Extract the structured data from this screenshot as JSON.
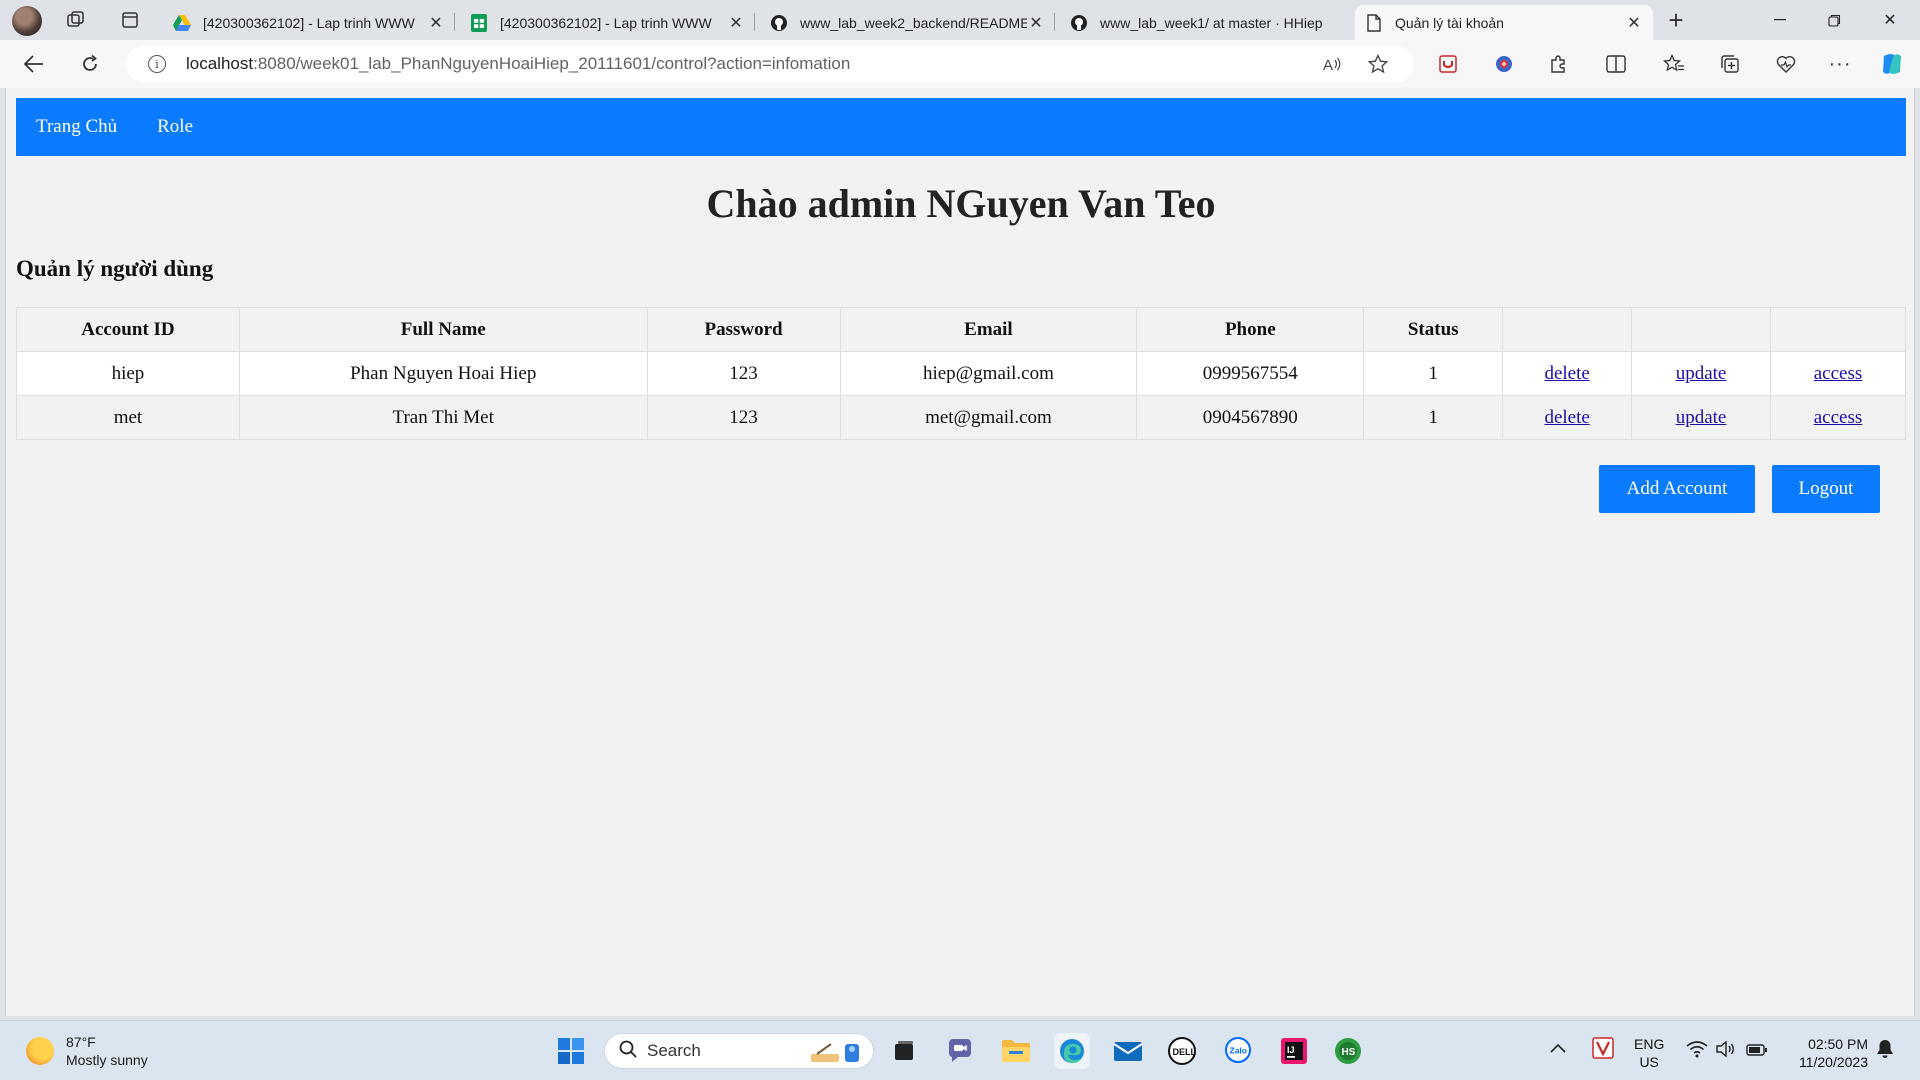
{
  "browser": {
    "tabs": [
      {
        "title": "[420300362102] - Lap trinh WWW",
        "icon": "google-drive-icon"
      },
      {
        "title": "[420300362102] - Lap trinh WWW",
        "icon": "google-sheets-icon"
      },
      {
        "title": "www_lab_week2_backend/README",
        "icon": "github-icon"
      },
      {
        "title": "www_lab_week1/ at master · HHiep",
        "icon": "github-icon"
      },
      {
        "title": "Quản lý tài khoản",
        "icon": "page-icon",
        "active": true
      }
    ],
    "url_host": "localhost",
    "url_path": ":8080/week01_lab_PhanNguyenHoaiHiep_20111601/control?action=infomation"
  },
  "page": {
    "nav": {
      "home": "Trang Chủ",
      "role": "Role"
    },
    "greeting": "Chào admin NGuyen Van Teo",
    "section_title": "Quản lý người dùng",
    "table": {
      "headers": [
        "Account ID",
        "Full Name",
        "Password",
        "Email",
        "Phone",
        "Status",
        "",
        "",
        ""
      ],
      "rows": [
        {
          "account_id": "hiep",
          "full_name": "Phan Nguyen Hoai Hiep",
          "password": "123",
          "email": "hiep@gmail.com",
          "phone": "0999567554",
          "status": "1",
          "delete": "delete",
          "update": "update",
          "access": "access"
        },
        {
          "account_id": "met",
          "full_name": "Tran Thi Met",
          "password": "123",
          "email": "met@gmail.com",
          "phone": "0904567890",
          "status": "1",
          "delete": "delete",
          "update": "update",
          "access": "access"
        }
      ]
    },
    "buttons": {
      "add_account": "Add Account",
      "logout": "Logout"
    }
  },
  "taskbar": {
    "weather_temp": "87°F",
    "weather_desc": "Mostly sunny",
    "search_placeholder": "Search",
    "lang_1": "ENG",
    "lang_2": "US",
    "time": "02:50 PM",
    "date": "11/20/2023"
  },
  "colors": {
    "accent": "#0a7bff",
    "link": "#1a0dab"
  }
}
